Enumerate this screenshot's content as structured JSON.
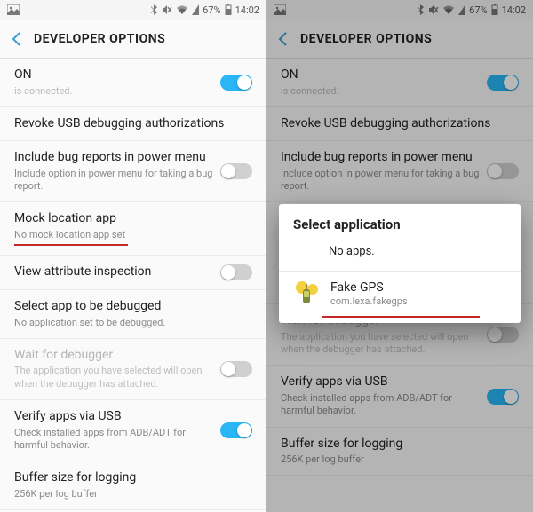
{
  "statusbar": {
    "battery": "67%",
    "time": "14:02"
  },
  "header": {
    "title": "DEVELOPER OPTIONS"
  },
  "left": {
    "on": {
      "title": "ON",
      "frag": "is connected."
    },
    "revoke": {
      "title": "Revoke USB debugging authorizations"
    },
    "bugreport": {
      "title": "Include bug reports in power menu",
      "sub": "Include option in power menu for taking a bug report."
    },
    "mock": {
      "title": "Mock location app",
      "sub": "No mock location app set"
    },
    "viewattr": {
      "title": "View attribute inspection"
    },
    "debugapp": {
      "title": "Select app to be debugged",
      "sub": "No application set to be debugged."
    },
    "wait": {
      "title": "Wait for debugger",
      "sub": "The application you have selected will open when the debugger has attached."
    },
    "verify": {
      "title": "Verify apps via USB",
      "sub": "Check installed apps from ADB/ADT for harmful behavior."
    },
    "buffer": {
      "title": "Buffer size for logging",
      "sub": "256K per log buffer"
    }
  },
  "right": {
    "on": {
      "title": "ON",
      "frag": "is connected."
    },
    "revoke": {
      "title": "Revoke USB debugging authorizations"
    },
    "bugreport": {
      "title": "Include bug reports in power menu",
      "sub": "Include option in power menu for taking a bug report."
    },
    "wait": {
      "title": "Wait for debugger",
      "sub": "The application you have selected will open when the debugger has attached."
    },
    "verify": {
      "title": "Verify apps via USB",
      "sub": "Check installed apps from ADB/ADT for harmful behavior."
    },
    "buffer": {
      "title": "Buffer size for logging",
      "sub": "256K per log buffer"
    }
  },
  "dialog": {
    "title": "Select application",
    "none": "No apps.",
    "app": {
      "name": "Fake GPS",
      "pkg": "com.lexa.fakegps"
    }
  }
}
